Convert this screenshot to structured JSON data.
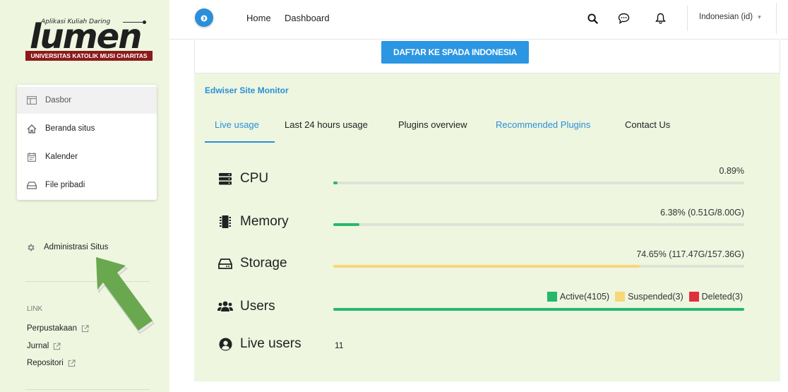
{
  "sidebar": {
    "logo": {
      "tagline": "Aplikasi Kuliah Daring",
      "name": "lumen",
      "university": "UNIVERSITAS KATOLIK MUSI CHARITAS"
    },
    "nav_items": [
      {
        "label": "Dasbor",
        "icon": "dashboard-icon",
        "active": true
      },
      {
        "label": "Beranda situs",
        "icon": "home-icon",
        "active": false
      },
      {
        "label": "Kalender",
        "icon": "calendar-icon",
        "active": false
      },
      {
        "label": "File pribadi",
        "icon": "drive-icon",
        "active": false
      }
    ],
    "admin_label": "Administrasi Situs",
    "link_heading": "LINK",
    "links": [
      {
        "label": "Perpustakaan"
      },
      {
        "label": "Jurnal"
      },
      {
        "label": "Repositori"
      }
    ]
  },
  "topbar": {
    "home": "Home",
    "dashboard": "Dashboard",
    "language": "Indonesian (id)"
  },
  "main": {
    "register_button": "DAFTAR KE SPADA INDONESIA",
    "monitor_title": "Edwiser Site Monitor",
    "tabs": [
      {
        "label": "Live usage",
        "active": true
      },
      {
        "label": "Last 24 hours usage",
        "active": false
      },
      {
        "label": "Plugins overview",
        "active": false
      },
      {
        "label": "Recommended Plugins",
        "active": false
      },
      {
        "label": "Contact Us",
        "active": false
      }
    ],
    "metrics": {
      "cpu": {
        "label": "CPU",
        "value_text": "0.89%",
        "fraction": 0.0089
      },
      "memory": {
        "label": "Memory",
        "value_text": "6.38% (0.51G/8.00G)",
        "fraction": 0.0638
      },
      "storage": {
        "label": "Storage",
        "value_text": "74.65% (117.47G/157.36G)",
        "fraction": 0.7465
      },
      "users": {
        "label": "Users",
        "legend": [
          {
            "label": "Active(4105)",
            "color": "#27b86b"
          },
          {
            "label": "Suspended(3)",
            "color": "#f7d77a"
          },
          {
            "label": "Deleted(3)",
            "color": "#e0303a"
          }
        ]
      },
      "live_users": {
        "label": "Live users",
        "value": "11"
      }
    }
  },
  "colors": {
    "accent": "#2a8fd8",
    "sidebar_bg": "#eef6e0",
    "cpu_bar": "#27b86b",
    "memory_bar": "#27b86b",
    "storage_bar": "#f7d77a",
    "users_bar": "#27b86b",
    "arrow": "#6aa84f"
  }
}
